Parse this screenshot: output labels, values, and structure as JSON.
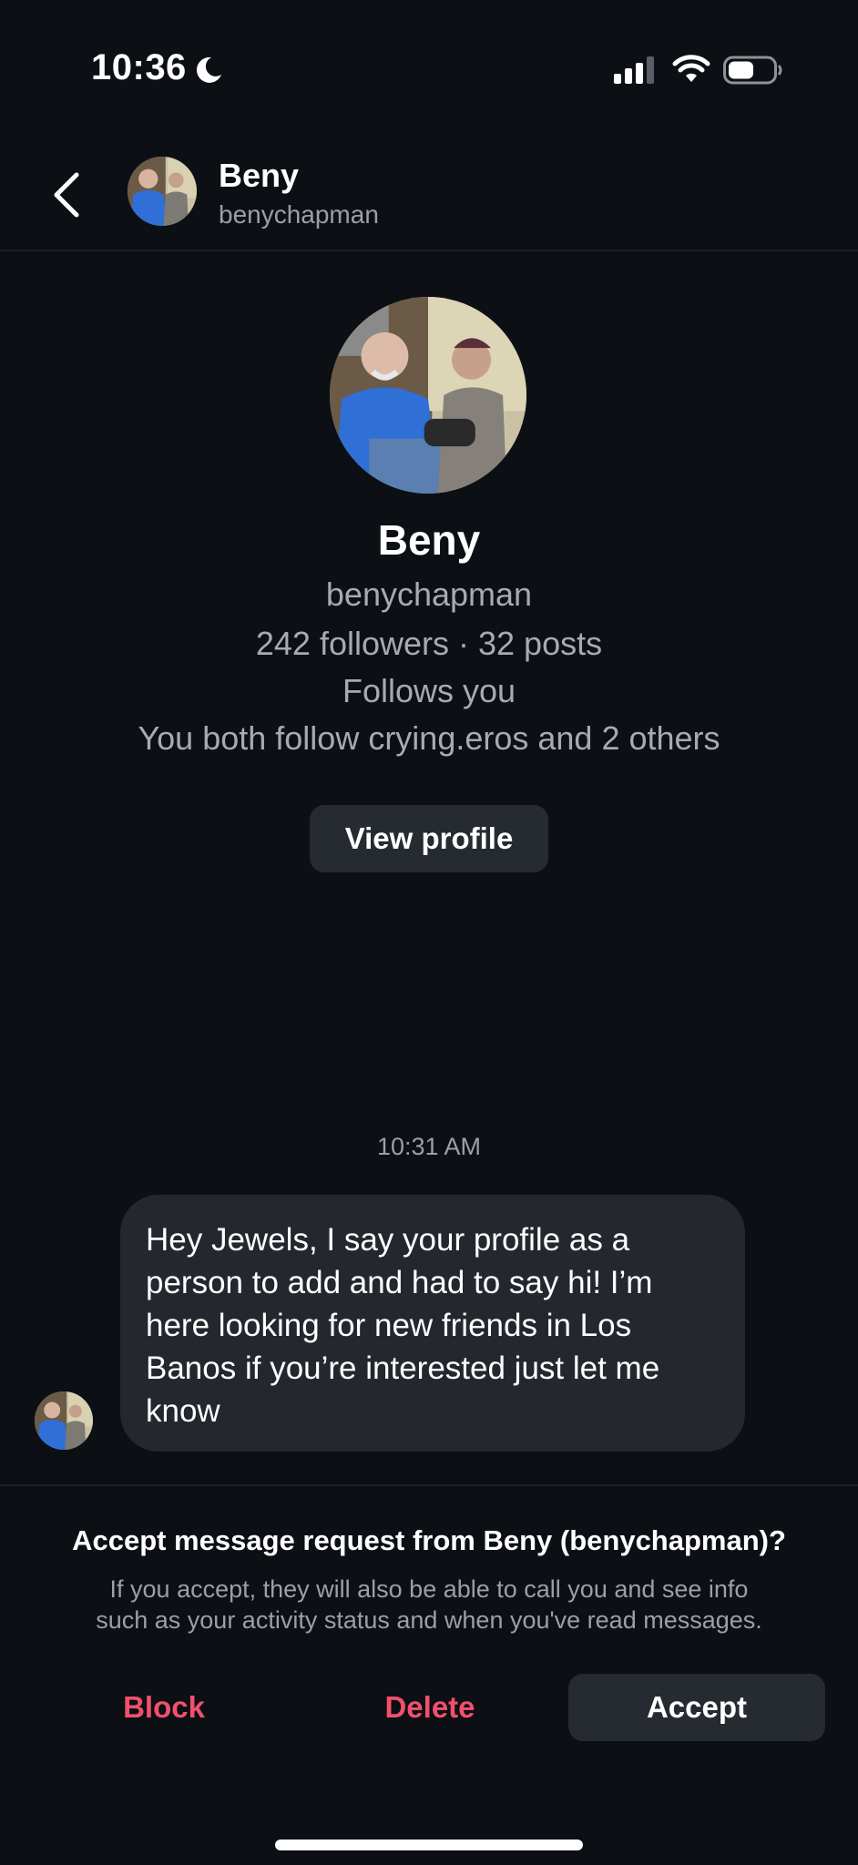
{
  "status_bar": {
    "time": "10:36",
    "icons": [
      "moon-icon",
      "signal-icon",
      "wifi-icon",
      "battery-icon"
    ]
  },
  "header": {
    "name": "Beny",
    "username": "benychapman",
    "back_icon": "chevron-left-icon"
  },
  "profile": {
    "name": "Beny",
    "username": "benychapman",
    "stats": "242 followers · 32 posts",
    "follows_you": "Follows you",
    "mutuals": "You both follow crying.eros and 2 others",
    "view_profile_label": "View profile"
  },
  "conversation": {
    "timestamp": "10:31 AM",
    "message_lines": [
      "Hey Jewels, I say your profile as a",
      "person to add and had to say hi! I’m",
      "here looking for new friends in Los",
      "Banos if you’re interested just let me",
      "know"
    ]
  },
  "request": {
    "title": "Accept message request from Beny (benychapman)?",
    "body_line1": "If you accept, they will also be able to call you and see info",
    "body_line2": "such as your activity status and when you've read messages.",
    "block_label": "Block",
    "delete_label": "Delete",
    "accept_label": "Accept"
  },
  "colors": {
    "background": "#0c0f14",
    "bubble": "#24272e",
    "button": "#262a31",
    "danger": "#f0506e",
    "muted_text": "#9aa0a8"
  }
}
